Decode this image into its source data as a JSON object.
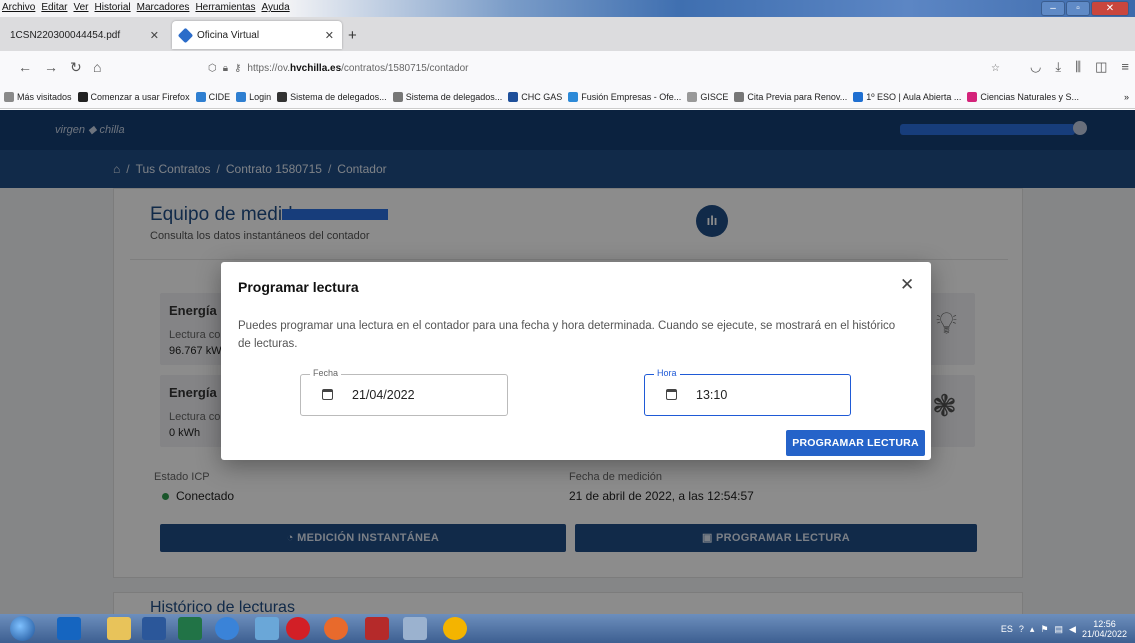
{
  "browser": {
    "menu": [
      "Archivo",
      "Editar",
      "Ver",
      "Historial",
      "Marcadores",
      "Herramientas",
      "Ayuda"
    ],
    "tabs": [
      {
        "label": "1CSN220300044454.pdf"
      },
      {
        "label": "Oficina Virtual"
      }
    ],
    "url_prefix": "https://ov.",
    "url_domain": "hvchilla.es",
    "url_path": "/contratos/1580715/contador",
    "bookmarks": [
      {
        "label": "Más visitados",
        "color": "#8a8a8a"
      },
      {
        "label": "Comenzar a usar Firefox",
        "color": "#222222"
      },
      {
        "label": "CIDE",
        "color": "#2f7fd1"
      },
      {
        "label": "Login",
        "color": "#2f7fd1"
      },
      {
        "label": "Sistema de delegados...",
        "color": "#333333"
      },
      {
        "label": "Sistema de delegados...",
        "color": "#777777"
      },
      {
        "label": "CHC GAS",
        "color": "#1e4f9a"
      },
      {
        "label": "Fusión Empresas - Ofe...",
        "color": "#2d8ad8"
      },
      {
        "label": "GISCE",
        "color": "#999999"
      },
      {
        "label": "Cita Previa para Renov...",
        "color": "#777777"
      },
      {
        "label": "1º ESO | Aula Abierta ...",
        "color": "#1f6fd1"
      },
      {
        "label": "Ciencias Naturales y S...",
        "color": "#d4237a"
      }
    ]
  },
  "site": {
    "logo": "virgen ◆ chilla",
    "breadcrumb": [
      "Tus Contratos",
      "Contrato 1580715",
      "Contador"
    ]
  },
  "card": {
    "title": "Equipo de medida",
    "subtitle": "Consulta los datos instantáneos del contador",
    "energy": [
      {
        "title": "Energía",
        "label": "Lectura co",
        "value": "96.767 kW"
      },
      {
        "title": "Energía",
        "label": "Lectura co",
        "value": "0 kWh"
      }
    ],
    "estado_label": "Estado ICP",
    "estado_value": "Conectado",
    "fecha_label": "Fecha de medición",
    "fecha_value": "21 de abril de 2022, a las 12:54:57",
    "btn_medicion": "MEDICIÓN INSTANTÁNEA",
    "btn_programar": "PROGRAMAR LECTURA",
    "next_title": "Histórico de lecturas"
  },
  "modal": {
    "title": "Programar lectura",
    "description": "Puedes programar una lectura en el contador para una fecha y hora determinada. Cuando se ejecute, se mostrará en el histórico de lecturas.",
    "fecha_label": "Fecha",
    "fecha_value": "21/04/2022",
    "hora_label": "Hora",
    "hora_value": "13:10",
    "submit": "PROGRAMAR LECTURA"
  },
  "taskbar": {
    "lang": "ES",
    "time": "12:56",
    "date": "21/04/2022"
  }
}
